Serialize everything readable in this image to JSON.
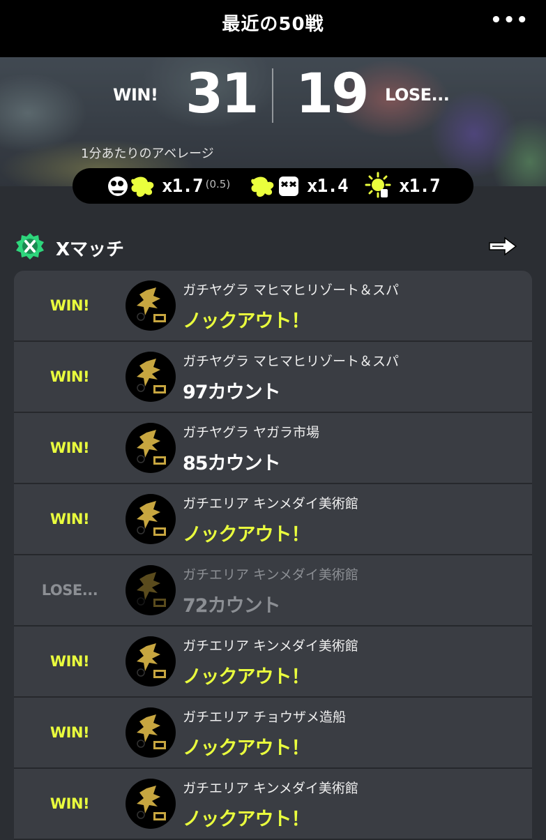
{
  "header": {
    "title": "最近の50戦",
    "more_label": "•••"
  },
  "score": {
    "win_label": "WIN!",
    "win_count": "31",
    "lose_count": "19",
    "lose_label": "LOSE..."
  },
  "average": {
    "label": "1分あたりのアベレージ",
    "stats": [
      {
        "icon": "splat-kill-icon",
        "value": "x1.7",
        "sub": "(0.5)"
      },
      {
        "icon": "splatted-death-icon",
        "value": "x1.4",
        "sub": ""
      },
      {
        "icon": "special-sun-icon",
        "value": "x1.7",
        "sub": ""
      }
    ]
  },
  "section": {
    "title": "Xマッチ",
    "badge_icon": "x-match-badge-icon",
    "link_icon": "arrow-right-icon"
  },
  "colors": {
    "accent_yellow": "#eaff3d",
    "lose_gray": "#8c8f94",
    "badge_green": "#2ed67c"
  },
  "battles": [
    {
      "result": "WIN!",
      "won": true,
      "mode_stage": "ガチヤグラ マヒマヒリゾート＆スパ",
      "outcome": "ノックアウト！",
      "ko": true
    },
    {
      "result": "WIN!",
      "won": true,
      "mode_stage": "ガチヤグラ マヒマヒリゾート＆スパ",
      "outcome": "97カウント",
      "ko": false
    },
    {
      "result": "WIN!",
      "won": true,
      "mode_stage": "ガチヤグラ ヤガラ市場",
      "outcome": "85カウント",
      "ko": false
    },
    {
      "result": "WIN!",
      "won": true,
      "mode_stage": "ガチエリア キンメダイ美術館",
      "outcome": "ノックアウト！",
      "ko": true
    },
    {
      "result": "LOSE...",
      "won": false,
      "mode_stage": "ガチエリア キンメダイ美術館",
      "outcome": "72カウント",
      "ko": false
    },
    {
      "result": "WIN!",
      "won": true,
      "mode_stage": "ガチエリア キンメダイ美術館",
      "outcome": "ノックアウト！",
      "ko": true
    },
    {
      "result": "WIN!",
      "won": true,
      "mode_stage": "ガチエリア チョウザメ造船",
      "outcome": "ノックアウト！",
      "ko": true
    },
    {
      "result": "WIN!",
      "won": true,
      "mode_stage": "ガチエリア キンメダイ美術館",
      "outcome": "ノックアウト！",
      "ko": true
    }
  ]
}
